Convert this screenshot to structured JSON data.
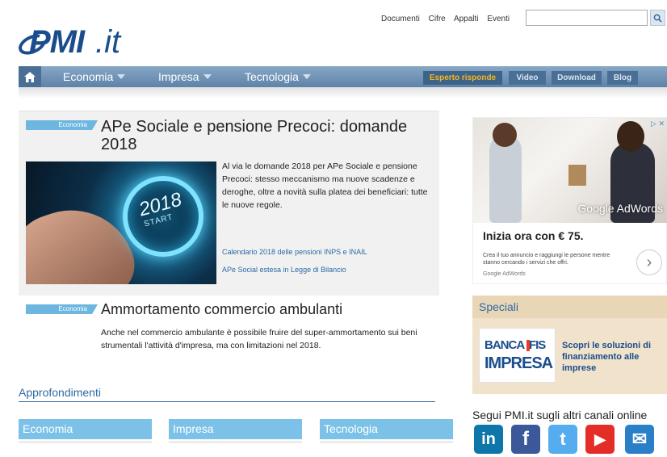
{
  "header": {
    "logo_main": "PMI",
    "logo_suffix": ".it",
    "top_links": [
      "Documenti",
      "Cifre",
      "Appalti",
      "Eventi"
    ],
    "search": {
      "value": "",
      "placeholder": ""
    }
  },
  "nav": {
    "items": [
      {
        "label": "Economia"
      },
      {
        "label": "Impresa"
      },
      {
        "label": "Tecnologia"
      }
    ],
    "pills": [
      {
        "label": "Esperto risponde"
      },
      {
        "label": "Video"
      },
      {
        "label": "Download"
      },
      {
        "label": "Blog"
      }
    ]
  },
  "articles": [
    {
      "tag": "Economia",
      "title": "APe Sociale e pensione Precoci: domande 2018",
      "image_text_year": "2018",
      "image_text_start": "START",
      "summary": "Al via le domande 2018 per APe Sociale e pensione Precoci: stesso meccanismo ma nuove scadenze e deroghe, oltre a novità sulla platea dei beneficiari: tutte le nuove regole.",
      "links": [
        "Calendario 2018 delle pensioni INPS e INAIL",
        "APe Social estesa in Legge di Bilancio"
      ]
    },
    {
      "tag": "Economia",
      "title": "Ammortamento commercio ambulanti",
      "summary": "Anche nel commercio ambulante è possibile fruire del super-ammortamento sui beni strumentali l'attività d'impresa, ma con limitazioni nel 2018."
    }
  ],
  "approfondimenti": {
    "title": "Approfondimenti",
    "categories": [
      "Economia",
      "Impresa",
      "Tecnologia"
    ]
  },
  "ad": {
    "brand": "Google AdWords",
    "headline": "Inizia ora con € 75.",
    "body": "Crea il tuo annuncio e raggiungi le persone mentre stanno cercando i servizi che offri.",
    "footer": "Google AdWords",
    "close_label": "▷ ✕"
  },
  "speciali": {
    "title": "Speciali",
    "logo_line1": "BANCA IFIS",
    "logo_line2": "IMPRESA",
    "link": "Scopri le soluzioni di finanziamento alle imprese"
  },
  "social": {
    "title": "Segui PMI.it sugli altri canali online",
    "items": [
      {
        "name": "linkedin",
        "glyph": "in",
        "color": "#0e76a8"
      },
      {
        "name": "facebook",
        "glyph": "f",
        "color": "#3b5998"
      },
      {
        "name": "twitter",
        "glyph": "t",
        "color": "#55acee"
      },
      {
        "name": "youtube",
        "glyph": "▶",
        "color": "#e52d27"
      },
      {
        "name": "newsletter",
        "glyph": "✉",
        "color": "#2a7fc9"
      }
    ]
  }
}
